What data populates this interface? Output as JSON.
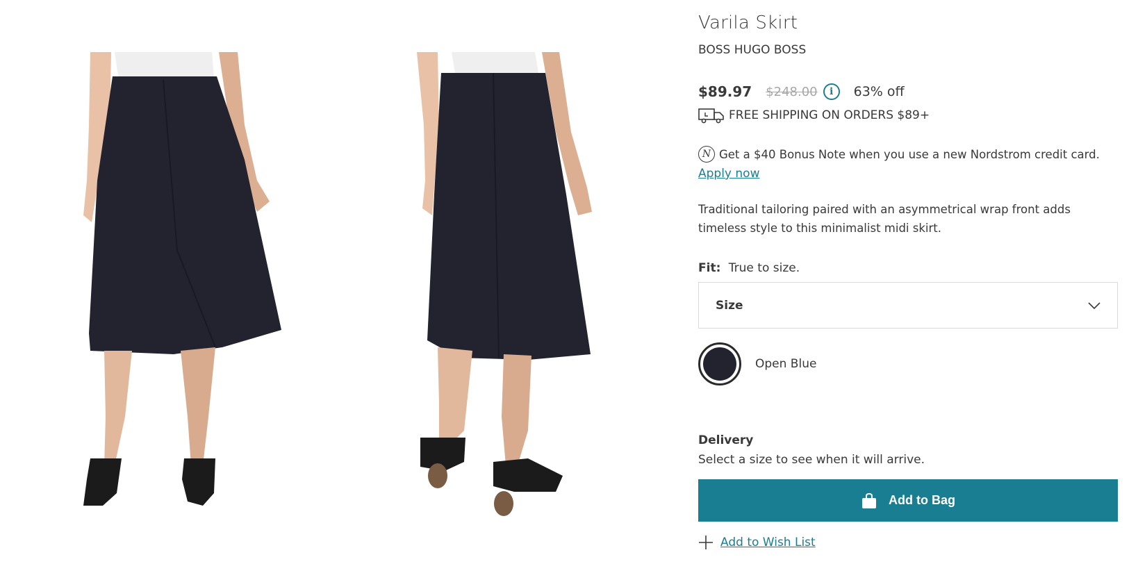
{
  "product": {
    "title": "Varila Skirt",
    "brand": "BOSS HUGO BOSS",
    "price_current": "$89.97",
    "price_original": "$248.00",
    "discount": "63% off",
    "shipping": "FREE SHIPPING ON ORDERS $89+",
    "bonus_note": "Get a $40 Bonus Note when you use a new Nordstrom credit card.",
    "apply_link": "Apply now",
    "description": "Traditional tailoring paired with an asymmetrical wrap front adds timeless style to this minimalist midi skirt.",
    "fit_label": "Fit:",
    "fit_value": "True to size.",
    "size_placeholder": "Size",
    "color_name": "Open Blue",
    "delivery_title": "Delivery",
    "delivery_text": "Select a size to see when it will arrive.",
    "add_to_bag": "Add to Bag",
    "add_to_wishlist": "Add to Wish List"
  },
  "icons": {
    "info": "info-icon",
    "truck": "truck-icon",
    "note": "nordstrom-note-icon",
    "chevron": "chevron-down-icon",
    "bag": "shopping-bag-icon",
    "plus": "plus-icon"
  },
  "colors": {
    "accent": "#1a7e92",
    "text": "#393939",
    "strike": "#a7a7a7",
    "skirt": "#23232f"
  }
}
